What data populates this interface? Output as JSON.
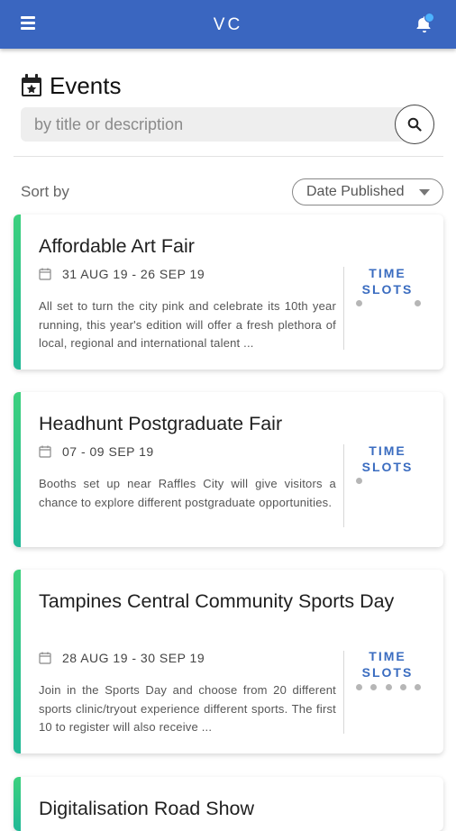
{
  "header": {
    "title": "VC",
    "menu_icon": "hamburger-menu-icon",
    "bell_icon": "notification-bell-icon"
  },
  "page": {
    "title": "Events",
    "title_icon": "calendar-star-icon"
  },
  "search": {
    "placeholder": "by title or description",
    "value": ""
  },
  "sort": {
    "label": "Sort by",
    "selected": "Date Published"
  },
  "accent_colors": {
    "header": "#3a66c0",
    "card_stripe": "#2ec88a",
    "time_slots": "#3a6cc0"
  },
  "events": [
    {
      "title": "Affordable Art Fair",
      "dates": "31 AUG 19 - 26 SEP 19",
      "description": "All set to turn the city pink and celebrate its 10th year running, this year's edition will offer a fresh plethora of local, regional and international talent ...",
      "slots_label": "TIME SLOTS",
      "slot_dots": 2
    },
    {
      "title": "Headhunt Postgraduate Fair",
      "dates": "07 - 09 SEP 19",
      "description": "Booths set up near Raffles City will give visitors a chance to explore different postgraduate opportunities.",
      "slots_label": "TIME SLOTS",
      "slot_dots": 1
    },
    {
      "title": "Tampines Central Community Sports Day",
      "dates": "28 AUG 19 - 30 SEP 19",
      "description": "Join in the Sports Day and choose from 20 different sports clinic/tryout experience different sports. The first 10 to register will also receive ...",
      "slots_label": "TIME SLOTS",
      "slot_dots": 5
    },
    {
      "title": "Digitalisation Road Show"
    }
  ]
}
